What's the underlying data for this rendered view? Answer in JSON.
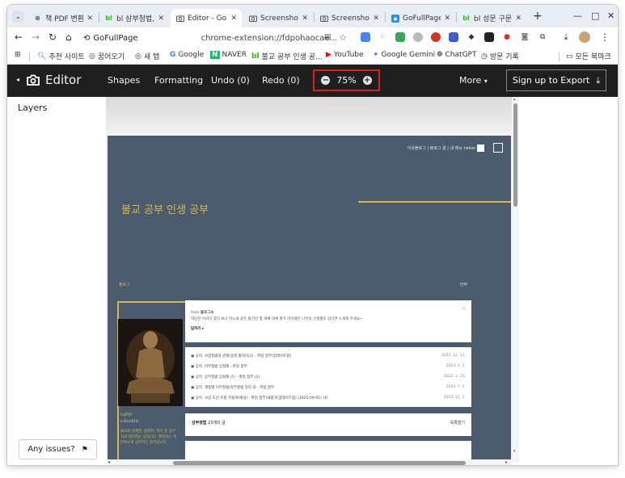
{
  "tabs": [
    {
      "title": "책 PDF 변환",
      "icon": "globe-icon"
    },
    {
      "title": "bl 삼부청법, 불교",
      "icon": "blog-icon"
    },
    {
      "title": "Editor - GoFullPage",
      "icon": "camera-icon",
      "active": true
    },
    {
      "title": "Screenshot",
      "icon": "camera-icon"
    },
    {
      "title": "Screenshot",
      "icon": "camera-icon"
    },
    {
      "title": "GoFullPage",
      "icon": "gofullpage-icon"
    },
    {
      "title": "bl 성문 구문, 불교",
      "icon": "blog-icon"
    }
  ],
  "window_controls": {
    "minimize": "—",
    "maximize": "□",
    "close": "✕"
  },
  "toolbar": {
    "site_chip": "GoFullPage",
    "url": "chrome-extension://fdpohaocae..."
  },
  "bookmarks": [
    {
      "label": "추천 사이트",
      "icon": "search-icon"
    },
    {
      "label": "꿈어오기",
      "icon": "import-icon"
    },
    {
      "label": "새 탭",
      "icon": "newtab-icon"
    },
    {
      "label": "Google",
      "icon": "google-icon"
    },
    {
      "label": "NAVER",
      "icon": "naver-icon"
    },
    {
      "label": "불교 공부 인생 공...",
      "icon": "blog-icon"
    },
    {
      "label": "YouTube",
      "icon": "youtube-icon"
    },
    {
      "label": "Google Gemini",
      "icon": "gemini-icon"
    },
    {
      "label": "ChatGPT",
      "icon": "chatgpt-icon"
    },
    {
      "label": "방문 기록",
      "icon": "history-icon"
    }
  ],
  "all_bookmarks": "모든 북마크",
  "editor": {
    "title": "Editor",
    "shapes": "Shapes",
    "formatting": "Formatting",
    "undo": "Undo (0)",
    "redo": "Redo (0)",
    "zoom": "75%",
    "more": "More",
    "export": "Sign up to Export"
  },
  "sidebar": {
    "layers": "Layers",
    "issues": "Any issues?"
  },
  "blog": {
    "topnav": "이웃블로그 | 블로그 홈 | 내 메뉴",
    "topnav_user": "twkos",
    "title": "불교 공부 인생 공부",
    "category": "블로그",
    "menu": "안부",
    "profile_name": "calm",
    "profile_sub": "(cdbc0810)",
    "profile_desc": "불교와 관세연, 컴퓨터, 영어 등 공부하고 정리하는 곳입니다. 편의하는 게반적으로 공부하는 분이입니다",
    "card1_from": "from",
    "card1_from_name": "블로그씨",
    "card1_text": "적당한 이야깃 찾다 보니 어느새 같은 볼건만 몇 개째 대체 뭘가 아이쨈던 나만의 인생쩜이 있다면 소개해 주세요~",
    "card1_more": "답하기 ▸",
    "posts": [
      {
        "tag": "공지",
        "title": "사염청법의 관계(승객 활자리(2) - 파일 첨부(업데이트함)",
        "date": "2022. 12. 11."
      },
      {
        "tag": "공지",
        "title": "이부청법 임성례 - 파일 첨부",
        "date": "2023. 4. 2."
      },
      {
        "tag": "공지",
        "title": "삼부청법 임성례 (1) - 파일 첨부 (2)",
        "date": "2023. 2. 25."
      },
      {
        "tag": "공지",
        "title": "계정별 이부청법/삼부청법 정리 표 - 파일 첨부",
        "date": "2024. 7. 2."
      },
      {
        "tag": "공지",
        "title": "사망 도인 흐름 지형개(예설) - 파일 첨부(새롭게 업데이트됨) (2025-09-01) (4)",
        "date": "2023. 11. 2."
      }
    ],
    "footer_title": "삼부청법",
    "footer_count": "23개의 글",
    "footer_list": "목록열기"
  }
}
